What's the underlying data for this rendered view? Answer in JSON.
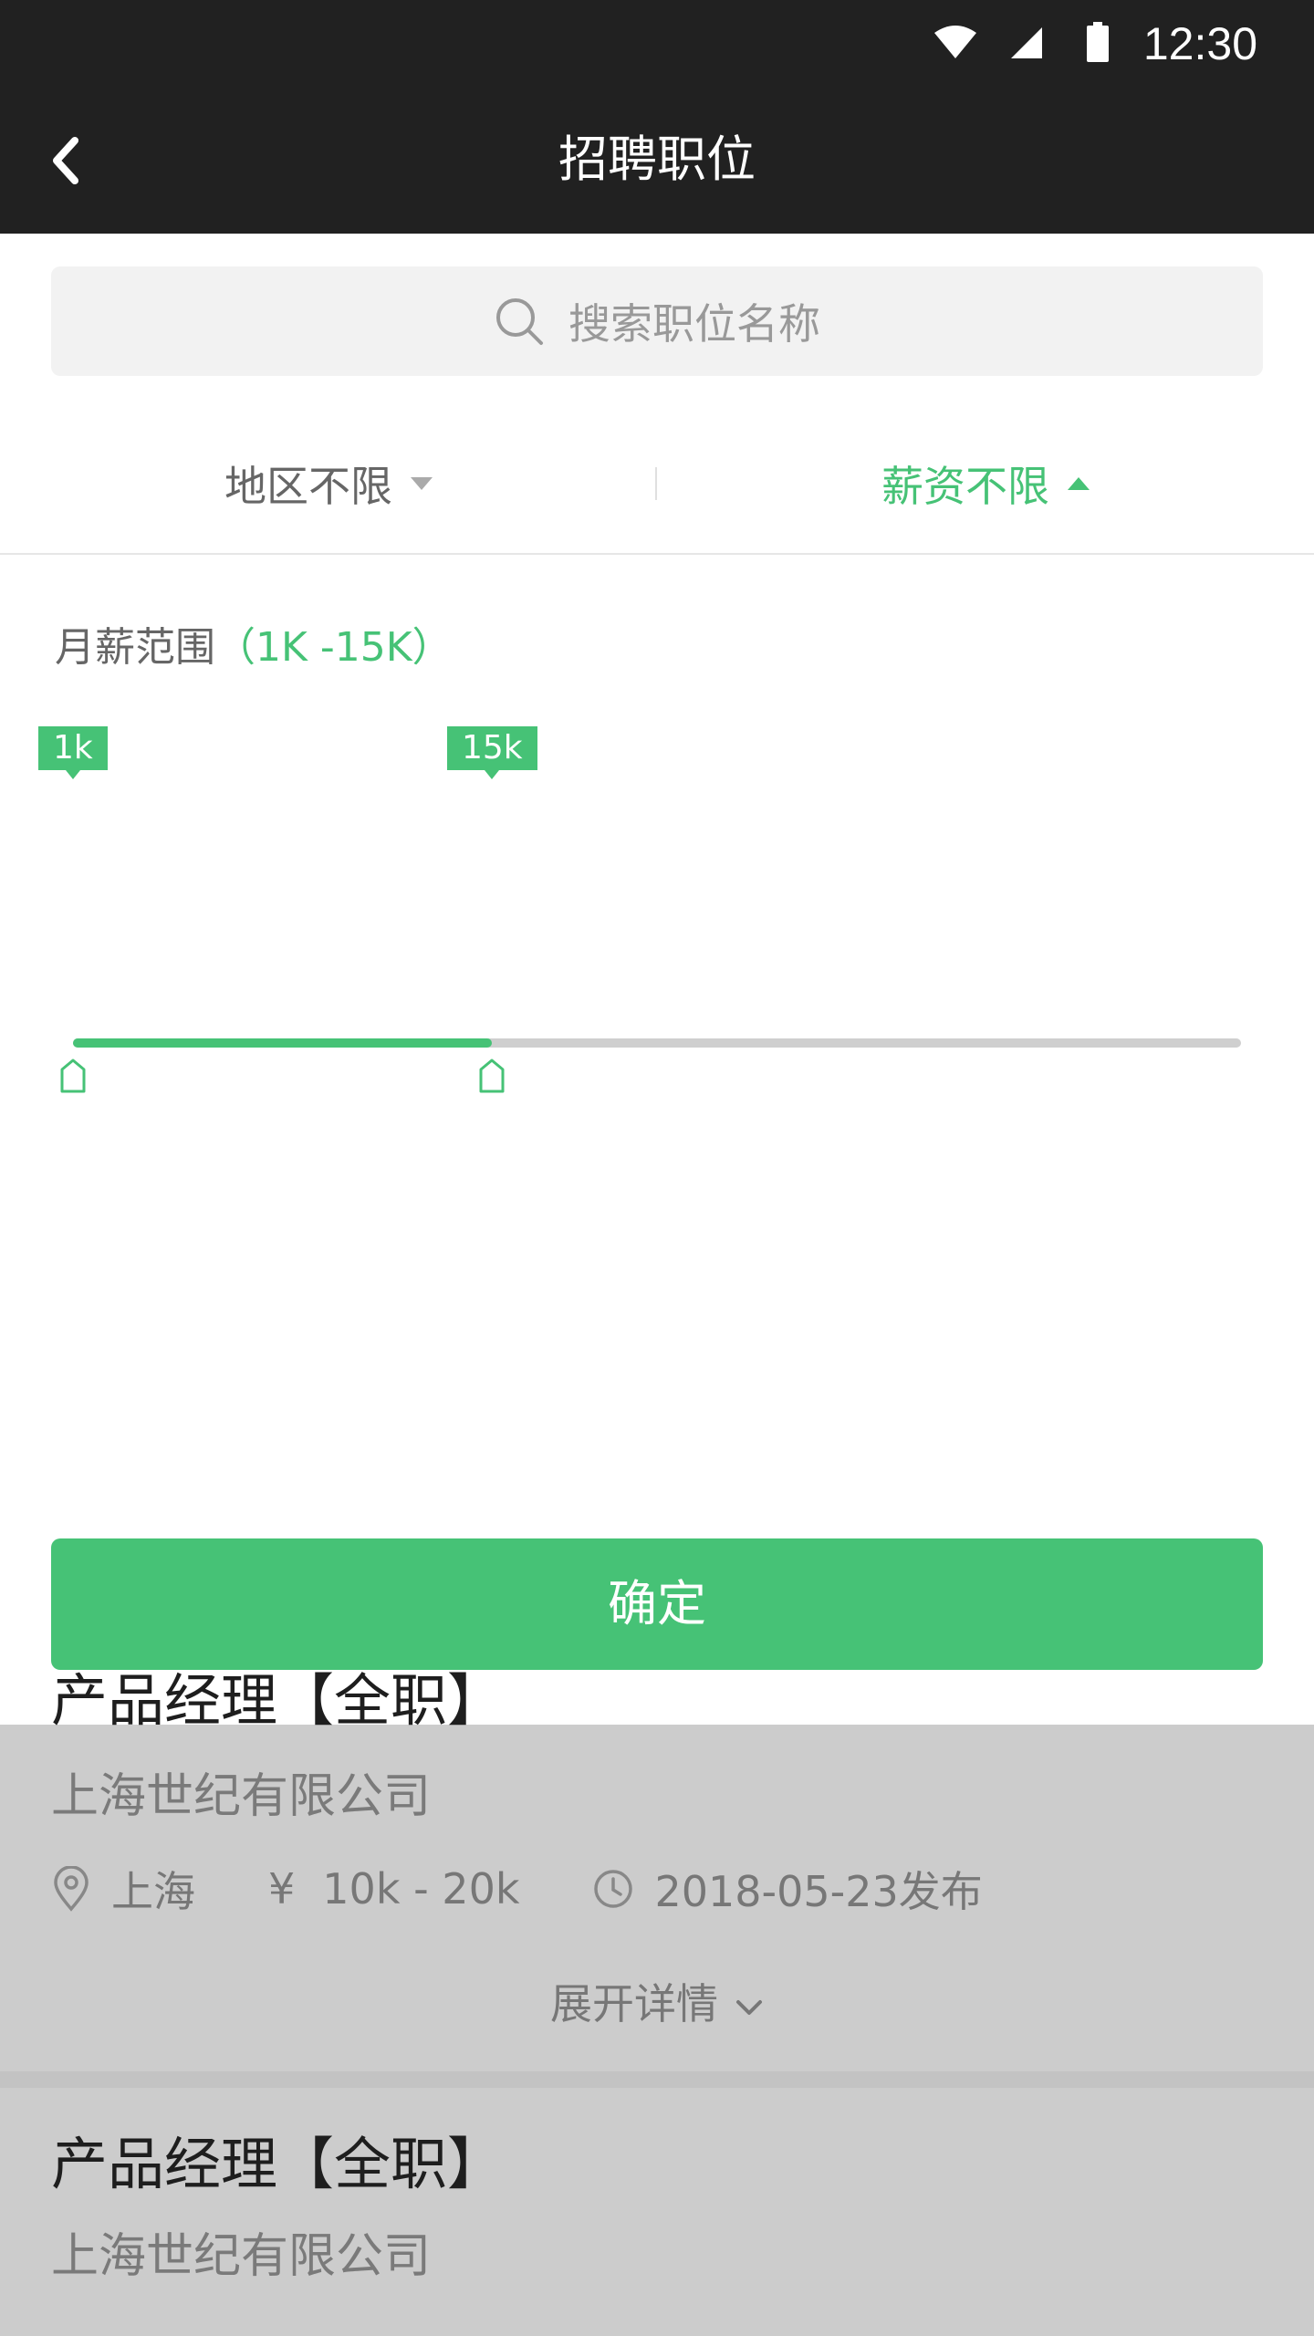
{
  "status_bar": {
    "time": "12:30",
    "icons": [
      "wifi-icon",
      "signal-icon",
      "battery-icon"
    ]
  },
  "app_bar": {
    "title": "招聘职位",
    "back_icon": "chevron-left-icon"
  },
  "search": {
    "placeholder": "搜索职位名称",
    "icon": "search-icon"
  },
  "filters": {
    "region": {
      "label": "地区不限",
      "state": "collapsed"
    },
    "salary": {
      "label": "薪资不限",
      "state": "expanded"
    }
  },
  "salary_panel": {
    "label": "月薪范围",
    "range_text": "（1K -15K）",
    "slider": {
      "min": 1,
      "max": 40,
      "low": 1,
      "high": 15,
      "low_tag": "1k",
      "high_tag": "15k"
    }
  },
  "confirm_label": "确定",
  "jobs": [
    {
      "title": "产品经理【全职】",
      "company": "上海世纪有限公司",
      "location": "上海",
      "salary": "10k - 20k",
      "date": "2018-05-23发布",
      "expand": "展开详情"
    },
    {
      "title": "产品经理【全职】",
      "company": "上海世纪有限公司"
    }
  ],
  "colors": {
    "accent": "#46c276",
    "bar": "#212121",
    "overlay": "#cccccc"
  }
}
